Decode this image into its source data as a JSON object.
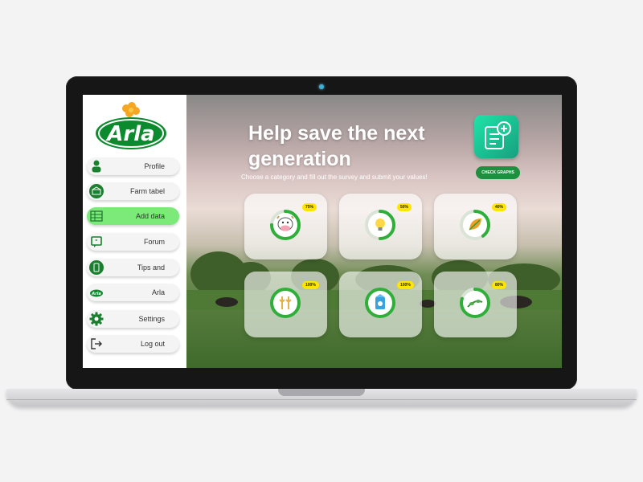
{
  "sidebar": {
    "logo_text": "Arla",
    "items": [
      {
        "label": "Profile",
        "icon": "person-icon"
      },
      {
        "label": "Farm tabel",
        "icon": "barn-icon"
      },
      {
        "label": "Add data",
        "icon": "table-icon",
        "active": true
      },
      {
        "label": "Forum",
        "icon": "chat-icon"
      },
      {
        "label": "Tips and",
        "icon": "tablet-icon"
      },
      {
        "label": "Arla",
        "icon": "arla-logo-icon"
      },
      {
        "label": "Settings",
        "icon": "gear-icon"
      },
      {
        "label": "Log out",
        "icon": "logout-icon"
      }
    ]
  },
  "main": {
    "title": "Help save the next generation",
    "subtitle": "Choose a category and fill out the survey and submit your values!",
    "check_graphs_label": "CHECK GRAPHS",
    "categories": [
      {
        "icon": "cow-icon",
        "percent_label": "75%",
        "progress": 0.75
      },
      {
        "icon": "lightbulb-icon",
        "percent_label": "50%",
        "progress": 0.5
      },
      {
        "icon": "leaf-icon",
        "percent_label": "40%",
        "progress": 0.4
      },
      {
        "icon": "wheat-icon",
        "percent_label": "100%",
        "progress": 1.0
      },
      {
        "icon": "milk-carton-icon",
        "percent_label": "100%",
        "progress": 1.0
      },
      {
        "icon": "plant-icon",
        "percent_label": "80%",
        "progress": 0.8
      }
    ]
  },
  "colors": {
    "accent_green": "#2fae3a",
    "active_nav": "#7bea78",
    "badge_yellow": "#ffe500",
    "arla_green": "#0c8a2e"
  }
}
